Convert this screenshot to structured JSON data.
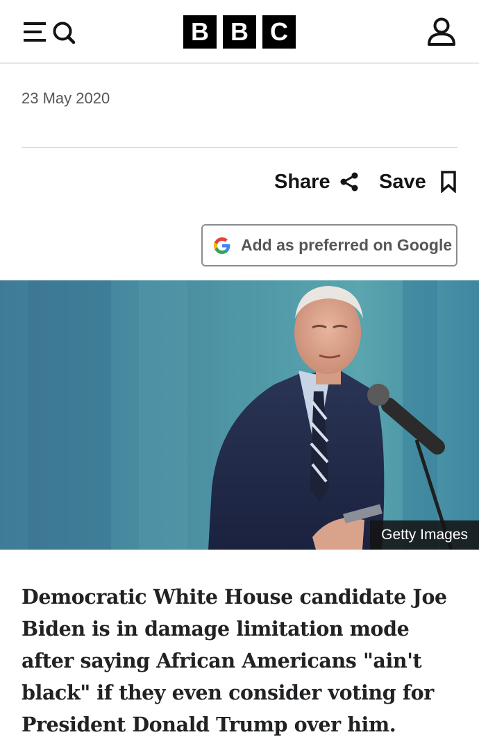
{
  "header": {
    "logo_letters": [
      "B",
      "B",
      "C"
    ],
    "menu_icon": "menu-icon",
    "search_icon": "search-icon",
    "account_icon": "account-icon"
  },
  "article": {
    "date": "23 May 2020",
    "share_label": "Share",
    "save_label": "Save",
    "google_button_label": "Add as preferred on Google",
    "image_credit": "Getty Images",
    "summary": "Democratic White House candidate Joe Biden is in damage limitation mode after saying African Americans \"ain't black\" if they even consider voting for President Donald Trump over him."
  },
  "colors": {
    "brand_black": "#000000",
    "text_dark": "#141414",
    "text_muted": "#545658",
    "divider": "#d9d9d9",
    "credit_background": "#141414"
  }
}
